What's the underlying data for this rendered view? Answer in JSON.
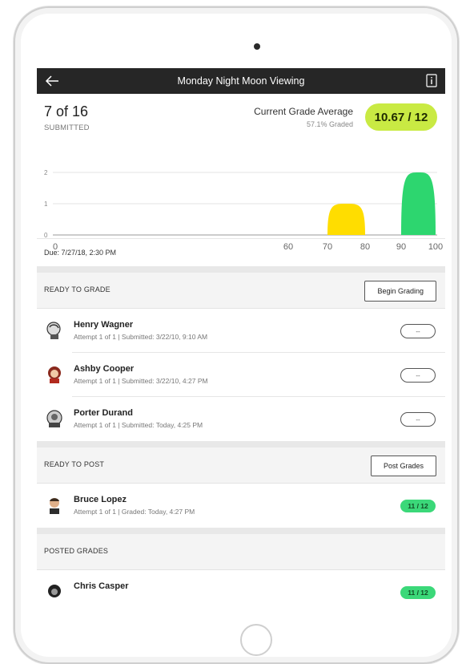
{
  "header": {
    "title": "Monday Night Moon Viewing"
  },
  "stats": {
    "count": "7 of 16",
    "submitted_label": "SUBMITTED",
    "grade_avg_label": "Current Grade Average",
    "graded_pct": "57.1% Graded",
    "grade_avg_value": "10.67 / 12"
  },
  "chart_data": {
    "type": "area",
    "y_ticks": [
      "2",
      "1",
      "0"
    ],
    "x_ticks": [
      "0",
      "60",
      "70",
      "80",
      "90",
      "100"
    ],
    "ylim": [
      0,
      2
    ],
    "series": [
      {
        "range": [
          70,
          80
        ],
        "peak": 1,
        "color": "#ffdd00"
      },
      {
        "range": [
          90,
          100
        ],
        "peak": 2,
        "color": "#2dd66f"
      }
    ]
  },
  "due": "Due: 7/27/18, 2:30 PM",
  "ready_to_grade": {
    "label": "READY TO GRADE",
    "button": "Begin Grading",
    "rows": [
      {
        "name": "Henry Wagner",
        "meta": "Attempt 1 of 1 | Submitted: 3/22/10, 9:10 AM",
        "grade": "--"
      },
      {
        "name": "Ashby Cooper",
        "meta": "Attempt 1 of 1 | Submitted: 3/22/10, 4:27 PM",
        "grade": "--"
      },
      {
        "name": "Porter Durand",
        "meta": "Attempt 1 of 1 | Submitted: Today, 4:25 PM",
        "grade": "--"
      }
    ]
  },
  "ready_to_post": {
    "label": "READY TO POST",
    "button": "Post Grades",
    "rows": [
      {
        "name": "Bruce Lopez",
        "meta": "Attempt 1 of 1 | Graded: Today, 4:27 PM",
        "grade": "11 / 12"
      }
    ]
  },
  "posted_grades": {
    "label": "POSTED GRADES",
    "rows": [
      {
        "name": "Chris Casper",
        "grade": "11 / 12"
      }
    ]
  }
}
